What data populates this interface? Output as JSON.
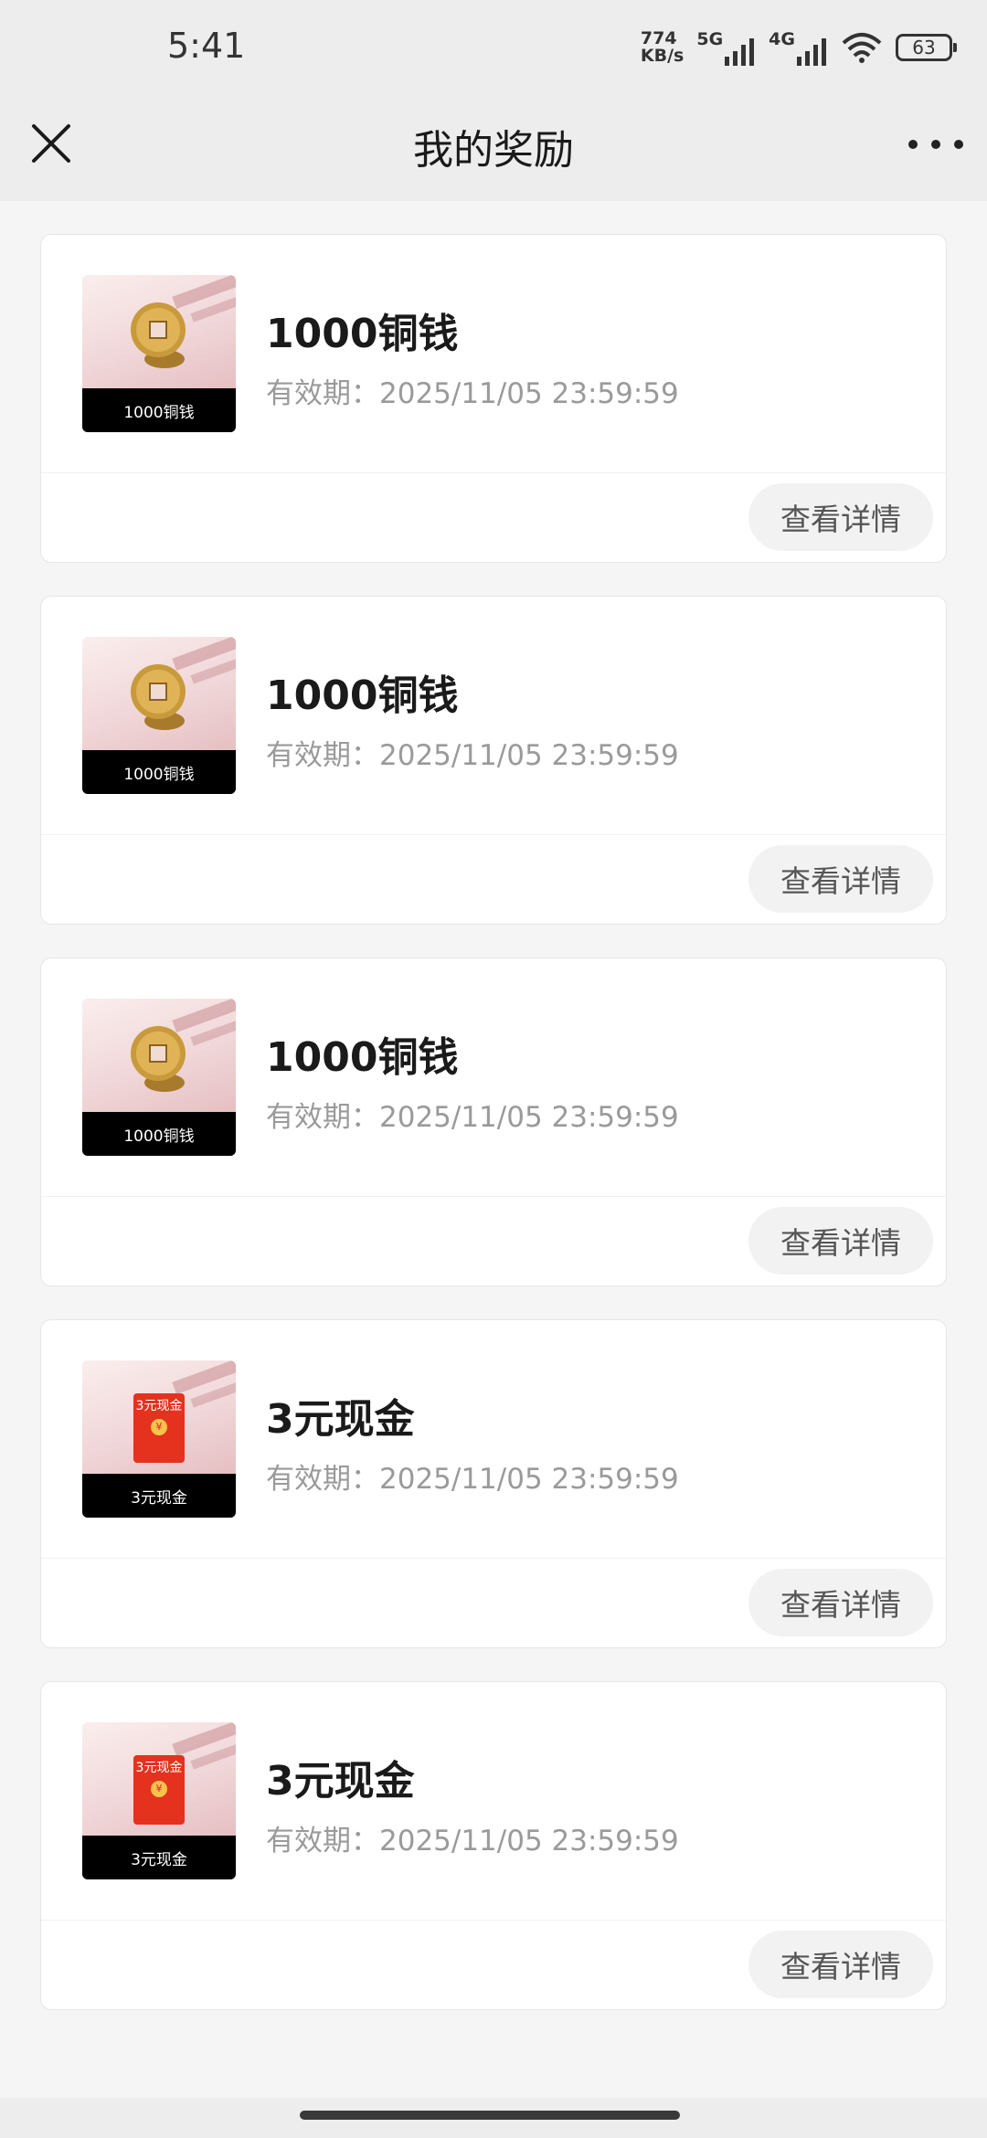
{
  "status_bar": {
    "time": "5:41",
    "speed_value": "774",
    "speed_unit": "KB/s",
    "net1": "5G",
    "net2": "4G",
    "battery": "63",
    "icons": [
      "signal-icon",
      "wifi-icon",
      "battery-icon"
    ]
  },
  "header": {
    "title": "我的奖励",
    "close_icon": "close-icon",
    "more_icon": "more-icon"
  },
  "rewards": [
    {
      "type": "coin",
      "thumb_label": "1000铜钱",
      "name": "1000铜钱",
      "expiry": "有效期：2025/11/05 23:59:59",
      "button": "查看详情"
    },
    {
      "type": "coin",
      "thumb_label": "1000铜钱",
      "name": "1000铜钱",
      "expiry": "有效期：2025/11/05 23:59:59",
      "button": "查看详情"
    },
    {
      "type": "coin",
      "thumb_label": "1000铜钱",
      "name": "1000铜钱",
      "expiry": "有效期：2025/11/05 23:59:59",
      "button": "查看详情"
    },
    {
      "type": "cash",
      "thumb_label": "3元现金",
      "thumb_text": "3元现金",
      "thumb_coin": "¥",
      "name": "3元现金",
      "expiry": "有效期：2025/11/05 23:59:59",
      "button": "查看详情"
    },
    {
      "type": "cash",
      "thumb_label": "3元现金",
      "thumb_text": "3元现金",
      "thumb_coin": "¥",
      "name": "3元现金",
      "expiry": "有效期：2025/11/05 23:59:59",
      "button": "查看详情"
    }
  ]
}
